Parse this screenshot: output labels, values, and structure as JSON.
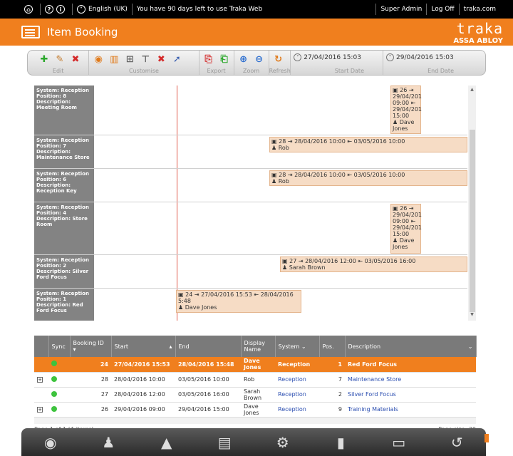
{
  "topbar": {
    "home_icon": "home-icon",
    "language": "English (UK)",
    "trial_message": "You have 90 days left to use Traka Web",
    "user": "Super Admin",
    "logoff": "Log Off",
    "site": "traka.com"
  },
  "header": {
    "title": "Item Booking",
    "logo_line1": "traka",
    "logo_line2": "ASSA ABLOY"
  },
  "toolbar": {
    "group_edit": "Edit",
    "group_customise": "Customise",
    "group_export": "Export",
    "group_zoom": "Zoom",
    "group_refresh": "Refresh",
    "start_date": "27/04/2016 15:03",
    "start_label": "Start Date",
    "end_date": "29/04/2016 15:03",
    "end_label": "End Date"
  },
  "timeline": {
    "rows": [
      {
        "l1": "System: Reception",
        "l2": "Position: 8",
        "l3": "Description: Meeting Room"
      },
      {
        "l1": "System: Reception",
        "l2": "Position: 7",
        "l3": "Description: Maintenance Store"
      },
      {
        "l1": "System: Reception",
        "l2": "Position: 6",
        "l3": "Description: Reception Key"
      },
      {
        "l1": "System: Reception",
        "l2": "Position: 4",
        "l3": "Description: Store Room"
      },
      {
        "l1": "System: Reception",
        "l2": "Position: 2",
        "l3": "Description: Silver Ford Focus"
      },
      {
        "l1": "System: Reception",
        "l2": "Position: 1",
        "l3": "Description: Red Ford Focus"
      }
    ],
    "bookings": {
      "b1": {
        "line1": "26 ",
        "line2": "29/04/201",
        "line3": "09:00",
        "line4": "29/04/201",
        "line5": "15:00",
        "line6": "Dave",
        "line7": "Jones"
      },
      "b2": {
        "line1": "28 ",
        "dates": "28/04/2016 10:00",
        "end": "03/05/2016 10:00",
        "who": "Rob"
      },
      "b3": {
        "line1": "28 ",
        "dates": "28/04/2016 10:00",
        "end": "03/05/2016 10:00",
        "who": "Rob"
      },
      "b4": {
        "line1": "26 ",
        "line2": "29/04/201",
        "line3": "09:00",
        "line4": "29/04/201",
        "line5": "15:00",
        "line6": "Dave",
        "line7": "Jones"
      },
      "b5": {
        "line1": "27 ",
        "dates": "28/04/2016 12:00",
        "end": "03/05/2016 16:00",
        "who": "Sarah Brown"
      },
      "b6": {
        "line1": "24 ",
        "dates": "27/04/2016 15:53",
        "end": "28/04/2016",
        "line2": "5:48",
        "who": "Dave Jones"
      }
    }
  },
  "grid": {
    "headers": {
      "sync": "Sync",
      "booking_id": "Booking ID",
      "start": "Start",
      "end": "End",
      "display_name": "Display Name",
      "system": "System",
      "pos": "Pos.",
      "description": "Description"
    },
    "rows": [
      {
        "id": "24",
        "start": "27/04/2016 15:53",
        "end": "28/04/2016 15:48",
        "name": "Dave Jones",
        "system": "Reception",
        "pos": "1",
        "desc": "Red Ford Focus"
      },
      {
        "id": "28",
        "start": "28/04/2016 10:00",
        "end": "03/05/2016 10:00",
        "name": "Rob",
        "system": "Reception",
        "pos": "7",
        "desc": "Maintenance Store"
      },
      {
        "id": "27",
        "start": "28/04/2016 12:00",
        "end": "03/05/2016 16:00",
        "name": "Sarah Brown",
        "system": "Reception",
        "pos": "2",
        "desc": "Silver Ford Focus"
      },
      {
        "id": "26",
        "start": "29/04/2016 09:00",
        "end": "29/04/2016 15:00",
        "name": "Dave Jones",
        "system": "Reception",
        "pos": "9",
        "desc": "Training Materials"
      }
    ],
    "pager_text": "Page 1 of 1 (4 items)",
    "page_size_label": "Page size:",
    "page_size": "20"
  }
}
